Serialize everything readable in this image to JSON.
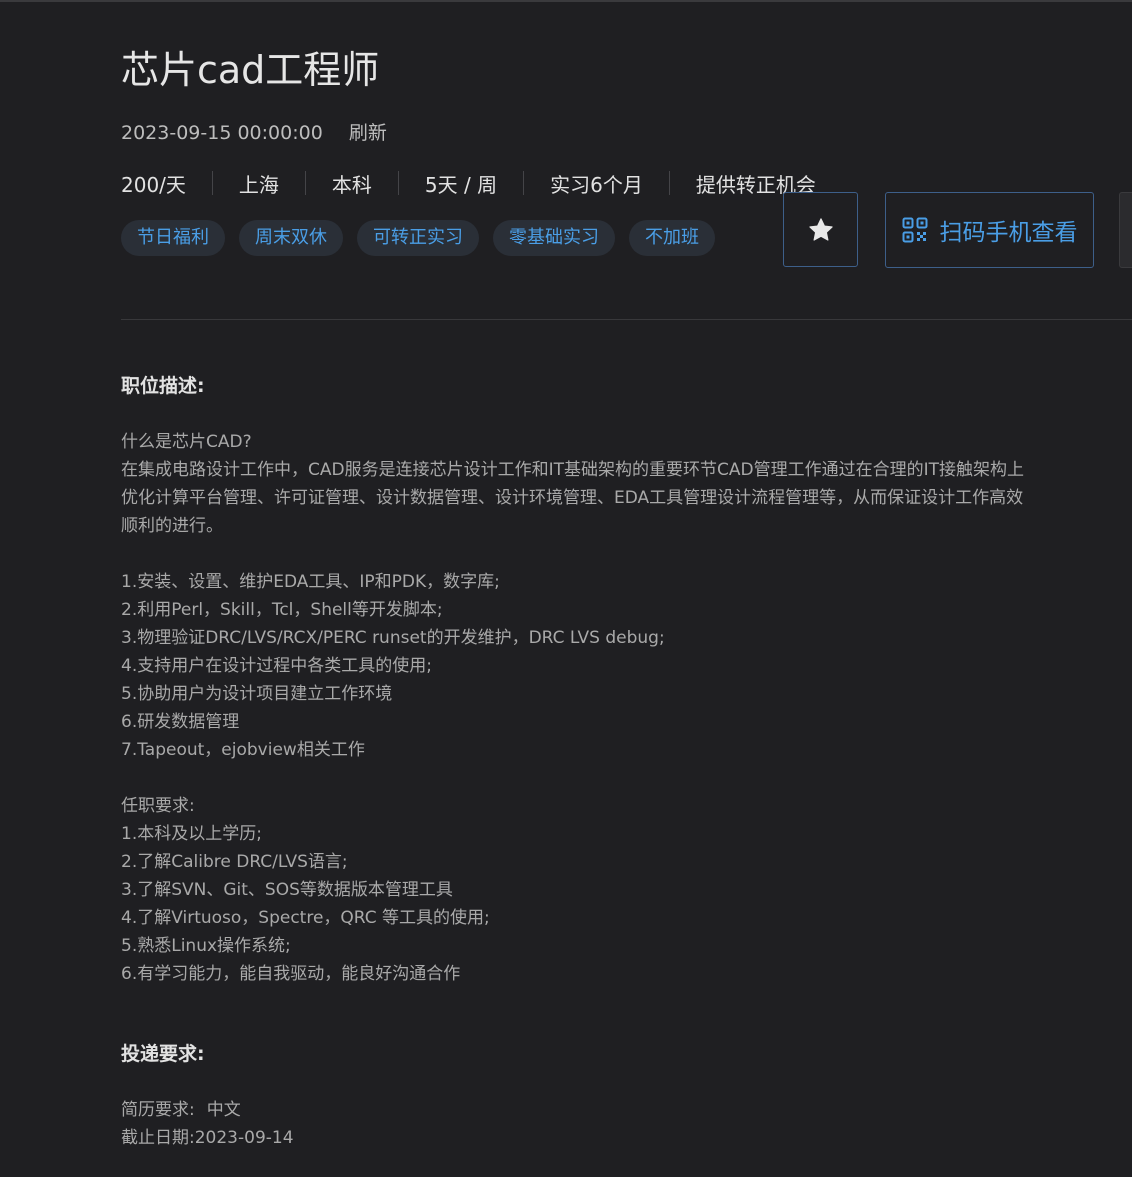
{
  "job": {
    "title": "芯片cad工程师",
    "date": "2023-09-15 00:00:00",
    "refresh_label": "刷新",
    "info": [
      "200/天",
      "上海",
      "本科",
      "5天 / 周",
      "实习6个月",
      "提供转正机会"
    ],
    "tags": [
      "节日福利",
      "周末双休",
      "可转正实习",
      "零基础实习",
      "不加班"
    ]
  },
  "actions": {
    "favorite_icon": "star-icon",
    "scan_label": "扫码手机查看",
    "scan_icon": "qrcode-icon"
  },
  "description": {
    "heading": "职位描述:",
    "lines": [
      "什么是芯片CAD?",
      "在集成电路设计工作中，CAD服务是连接芯片设计工作和IT基础架构的重要环节CAD管理工作通过在合理的IT接触架构上",
      "优化计算平台管理、许可证管理、设计数据管理、设计环境管理、EDA工具管理设计流程管理等，从而保证设计工作高效",
      "顺利的进行。",
      "",
      "1.安装、设置、维护EDA工具、IP和PDK，数字库;",
      "2.利用Perl，Skill，Tcl，Shell等开发脚本;",
      "3.物理验证DRC/LVS/RCX/PERC runset的开发维护，DRC LVS debug;",
      "4.支持用户在设计过程中各类工具的使用;",
      "5.协助用户为设计项目建立工作环境",
      "6.研发数据管理",
      "7.Tapeout，ejobview相关工作",
      "",
      "任职要求:",
      "1.本科及以上学历;",
      "2.了解Calibre DRC/LVS语言;",
      "3.了解SVN、Git、SOS等数据版本管理工具",
      "4.了解Virtuoso，Spectre，QRC 等工具的使用;",
      "5.熟悉Linux操作系统;",
      "6.有学习能力，能自我驱动，能良好沟通合作"
    ]
  },
  "delivery": {
    "heading": "投递要求:",
    "resume_label": "简历要求:",
    "resume_value": "中文",
    "deadline_label": "截止日期:",
    "deadline_value": "2023-09-14"
  }
}
